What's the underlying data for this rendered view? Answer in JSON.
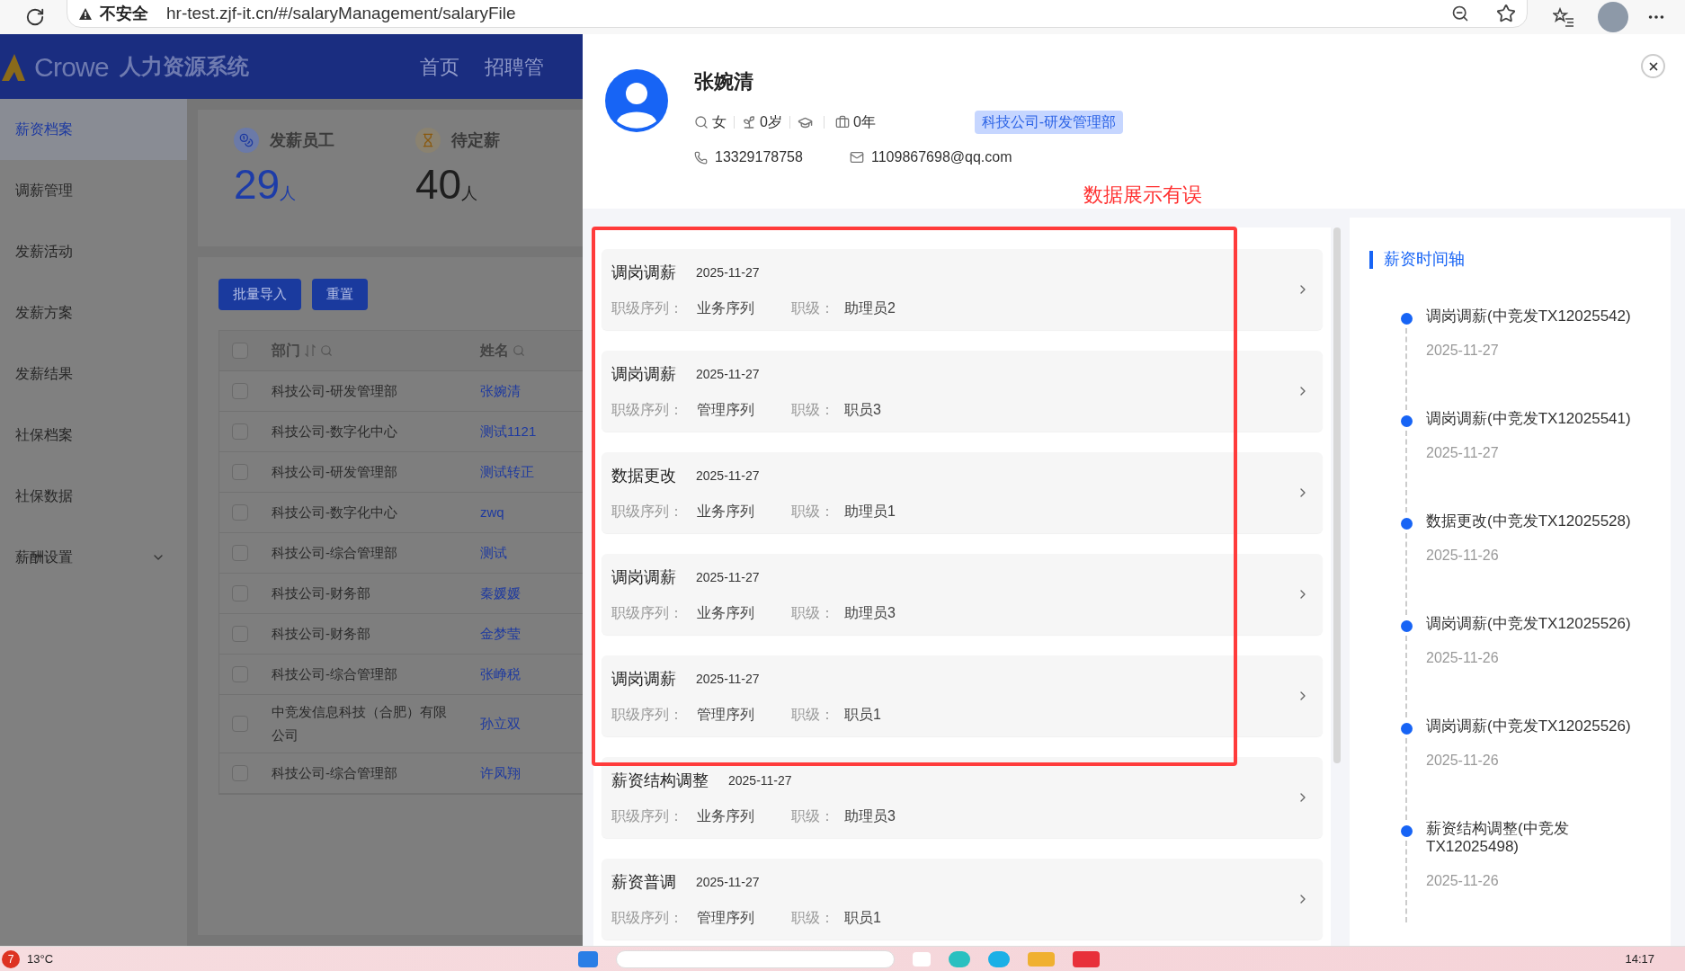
{
  "browser": {
    "security": "不安全",
    "url": "hr-test.zjf-it.cn/#/salaryManagement/salaryFile"
  },
  "app": {
    "logo": "Crowe",
    "system_name": "人力资源系统",
    "nav": [
      {
        "label": "首页",
        "selected": false
      },
      {
        "label": "招聘管",
        "selected": false
      }
    ]
  },
  "sidebar": {
    "items": [
      {
        "label": "薪资档案",
        "selected": true,
        "expandable": false
      },
      {
        "label": "调薪管理",
        "selected": false,
        "expandable": false
      },
      {
        "label": "发薪活动",
        "selected": false,
        "expandable": false
      },
      {
        "label": "发薪方案",
        "selected": false,
        "expandable": false
      },
      {
        "label": "发薪结果",
        "selected": false,
        "expandable": false
      },
      {
        "label": "社保档案",
        "selected": false,
        "expandable": false
      },
      {
        "label": "社保数据",
        "selected": false,
        "expandable": false
      },
      {
        "label": "薪酬设置",
        "selected": false,
        "expandable": true
      }
    ]
  },
  "stats": [
    {
      "kind": "primary",
      "label": "发薪员工",
      "value": "29",
      "unit": "人"
    },
    {
      "kind": "plain",
      "label": "待定薪",
      "value": "40",
      "unit": "人"
    }
  ],
  "toolbar": {
    "buttons": [
      "批量导入",
      "重置"
    ]
  },
  "table": {
    "all_checked": false,
    "columns": [
      {
        "label": "部门",
        "sortable": true
      },
      {
        "label": "姓名",
        "sortable": false
      }
    ],
    "rows": [
      {
        "checked": false,
        "department": "科技公司-研发管理部",
        "name": "张婉清"
      },
      {
        "checked": false,
        "department": "科技公司-数字化中心",
        "name": "测试1121"
      },
      {
        "checked": false,
        "department": "科技公司-研发管理部",
        "name": "测试转正"
      },
      {
        "checked": false,
        "department": "科技公司-数字化中心",
        "name": "zwq"
      },
      {
        "checked": false,
        "department": "科技公司-综合管理部",
        "name": "测试"
      },
      {
        "checked": false,
        "department": "科技公司-财务部",
        "name": "秦媛媛"
      },
      {
        "checked": false,
        "department": "科技公司-财务部",
        "name": "金梦莹"
      },
      {
        "checked": false,
        "department": "科技公司-综合管理部",
        "name": "张峥税"
      },
      {
        "checked": false,
        "department": "中竞发信息科技（合肥）有限公司",
        "name": "孙立双"
      },
      {
        "checked": false,
        "department": "科技公司-综合管理部",
        "name": "许凤翔"
      }
    ]
  },
  "drawer": {
    "name": "张婉清",
    "gender": "女",
    "age": "0岁",
    "years": "0年",
    "department_tag": "科技公司-研发管理部",
    "phone": "13329178758",
    "email": "1109867698@qq.com",
    "notice": "数据展示有误",
    "records": [
      {
        "type": "调岗调薪",
        "date": "2025-11-27",
        "sequence_label": "职级序列：",
        "sequence": "业务序列",
        "grade_label": "职级：",
        "grade": "助理员2"
      },
      {
        "type": "调岗调薪",
        "date": "2025-11-27",
        "sequence_label": "职级序列：",
        "sequence": "管理序列",
        "grade_label": "职级：",
        "grade": "职员3"
      },
      {
        "type": "数据更改",
        "date": "2025-11-27",
        "sequence_label": "职级序列：",
        "sequence": "业务序列",
        "grade_label": "职级：",
        "grade": "助理员1"
      },
      {
        "type": "调岗调薪",
        "date": "2025-11-27",
        "sequence_label": "职级序列：",
        "sequence": "业务序列",
        "grade_label": "职级：",
        "grade": "助理员3"
      },
      {
        "type": "调岗调薪",
        "date": "2025-11-27",
        "sequence_label": "职级序列：",
        "sequence": "管理序列",
        "grade_label": "职级：",
        "grade": "职员1"
      },
      {
        "type": "薪资结构调整",
        "date": "2025-11-27",
        "sequence_label": "职级序列：",
        "sequence": "业务序列",
        "grade_label": "职级：",
        "grade": "助理员3"
      },
      {
        "type": "薪资普调",
        "date": "2025-11-27",
        "sequence_label": "职级序列：",
        "sequence": "管理序列",
        "grade_label": "职级：",
        "grade": "职员1"
      }
    ],
    "timeline": {
      "title": "薪资时间轴",
      "items": [
        {
          "title": "调岗调薪(中竞发TX12025542)",
          "date": "2025-11-27"
        },
        {
          "title": "调岗调薪(中竞发TX12025541)",
          "date": "2025-11-27"
        },
        {
          "title": "数据更改(中竞发TX12025528)",
          "date": "2025-11-26"
        },
        {
          "title": "调岗调薪(中竞发TX12025526)",
          "date": "2025-11-26"
        },
        {
          "title": "调岗调薪(中竞发TX12025526)",
          "date": "2025-11-26"
        },
        {
          "title": "薪资结构调整(中竞发TX12025498)",
          "date": "2025-11-26"
        }
      ]
    }
  },
  "taskbar": {
    "badge": "7",
    "weather": "13°C",
    "time": "14:17"
  }
}
